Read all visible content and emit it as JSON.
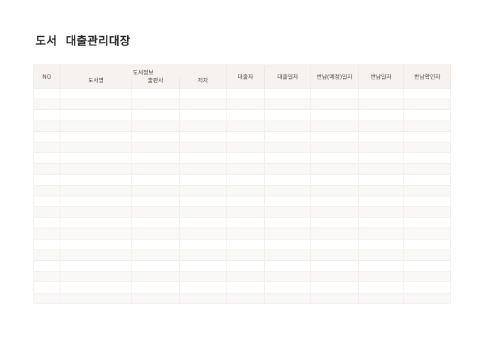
{
  "document": {
    "title": "도서  대출관리대장"
  },
  "table": {
    "headers": {
      "no": "NO",
      "book_info_group": "도서정보",
      "book_title": "도서명",
      "publisher": "출판사",
      "author": "저자",
      "borrower": "대출자",
      "loan_date": "대출일자",
      "due_date": "반납(예정)일자",
      "return_date": "반납일자",
      "return_check": "반납확인자"
    },
    "row_count": 20
  }
}
